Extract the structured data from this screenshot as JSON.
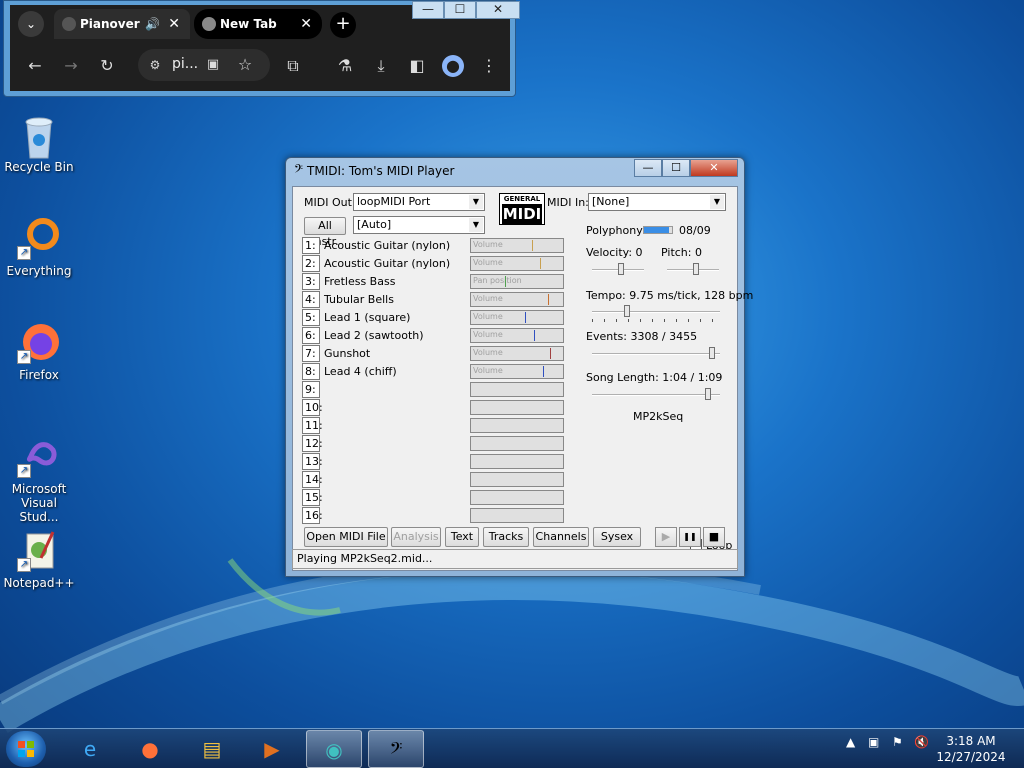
{
  "browser": {
    "tabs": [
      {
        "label": "Pianover",
        "audio_icon": "speaker-icon"
      },
      {
        "label": "New Tab"
      }
    ],
    "omnibox_text": "pi...",
    "window_buttons": [
      "—",
      "☐",
      "✕"
    ]
  },
  "desktop_icons": [
    {
      "label": "Recycle Bin",
      "icon": "recycle-bin-icon"
    },
    {
      "label": "Everything",
      "icon": "everything-icon"
    },
    {
      "label": "Firefox",
      "icon": "firefox-icon"
    },
    {
      "label": "Microsoft Visual Stud...",
      "icon": "visual-studio-icon"
    },
    {
      "label": "Notepad++",
      "icon": "notepadpp-icon"
    }
  ],
  "tmidi": {
    "title": "TMIDI: Tom's MIDI Player",
    "midi_out_label": "MIDI Out:",
    "midi_out_value": "loopMIDI Port",
    "midi_in_label": "MIDI In:",
    "midi_in_value": "[None]",
    "all_instr_label": "All Instr.",
    "instr_value": "[Auto]",
    "gm_logo_top": "GENERAL",
    "gm_logo_bottom": "MIDI",
    "channels": [
      {
        "num": "1:",
        "name": "Acoustic Guitar (nylon)",
        "meter_label": "Volume",
        "level": 0.68,
        "mark_color": "#c8a050"
      },
      {
        "num": "2:",
        "name": "Acoustic Guitar (nylon)",
        "meter_label": "Volume",
        "level": 0.77,
        "mark_color": "#c8a050"
      },
      {
        "num": "3:",
        "name": "Fretless Bass",
        "meter_label": "Pan position",
        "level": 0.38,
        "mark_color": "#50a050"
      },
      {
        "num": "4:",
        "name": "Tubular Bells",
        "meter_label": "Volume",
        "level": 0.86,
        "mark_color": "#c87030"
      },
      {
        "num": "5:",
        "name": "Lead 1 (square)",
        "meter_label": "Volume",
        "level": 0.6,
        "mark_color": "#3050c0"
      },
      {
        "num": "6:",
        "name": "Lead 2 (sawtooth)",
        "meter_label": "Volume",
        "level": 0.7,
        "mark_color": "#3050c0"
      },
      {
        "num": "7:",
        "name": "Gunshot",
        "meter_label": "Volume",
        "level": 0.88,
        "mark_color": "#a04040"
      },
      {
        "num": "8:",
        "name": "Lead 4 (chiff)",
        "meter_label": "Volume",
        "level": 0.8,
        "mark_color": "#3050c0"
      },
      {
        "num": "9:",
        "name": "",
        "meter_label": ""
      },
      {
        "num": "10:",
        "name": "",
        "meter_label": ""
      },
      {
        "num": "11:",
        "name": "",
        "meter_label": ""
      },
      {
        "num": "12:",
        "name": "",
        "meter_label": ""
      },
      {
        "num": "13:",
        "name": "",
        "meter_label": ""
      },
      {
        "num": "14:",
        "name": "",
        "meter_label": ""
      },
      {
        "num": "15:",
        "name": "",
        "meter_label": ""
      },
      {
        "num": "16:",
        "name": "",
        "meter_label": ""
      }
    ],
    "polyphony_label": "Polyphony:",
    "polyphony_value": "08/09",
    "polyphony_level": 0.89,
    "velocity_label": "Velocity: 0",
    "pitch_label": "Pitch: 0",
    "tempo_label": "Tempo: 9.75 ms/tick, 128 bpm",
    "events_label": "Events: 3308 / 3455",
    "events_level": 0.96,
    "song_length_label": "Song Length: 1:04 / 1:09",
    "song_level": 0.93,
    "sequence_name": "MP2kSeq",
    "loop_label": "Loop",
    "loop_checked": "✓",
    "buttons": {
      "open": "Open MIDI File",
      "analysis": "Analysis",
      "text": "Text",
      "tracks": "Tracks",
      "channels": "Channels",
      "sysex": "Sysex",
      "play": "▶",
      "pause": "❚❚",
      "stop": "■"
    },
    "status": "Playing MP2kSeq2.mid..."
  },
  "taskbar": {
    "time": "3:18 AM",
    "date": "12/27/2024"
  }
}
